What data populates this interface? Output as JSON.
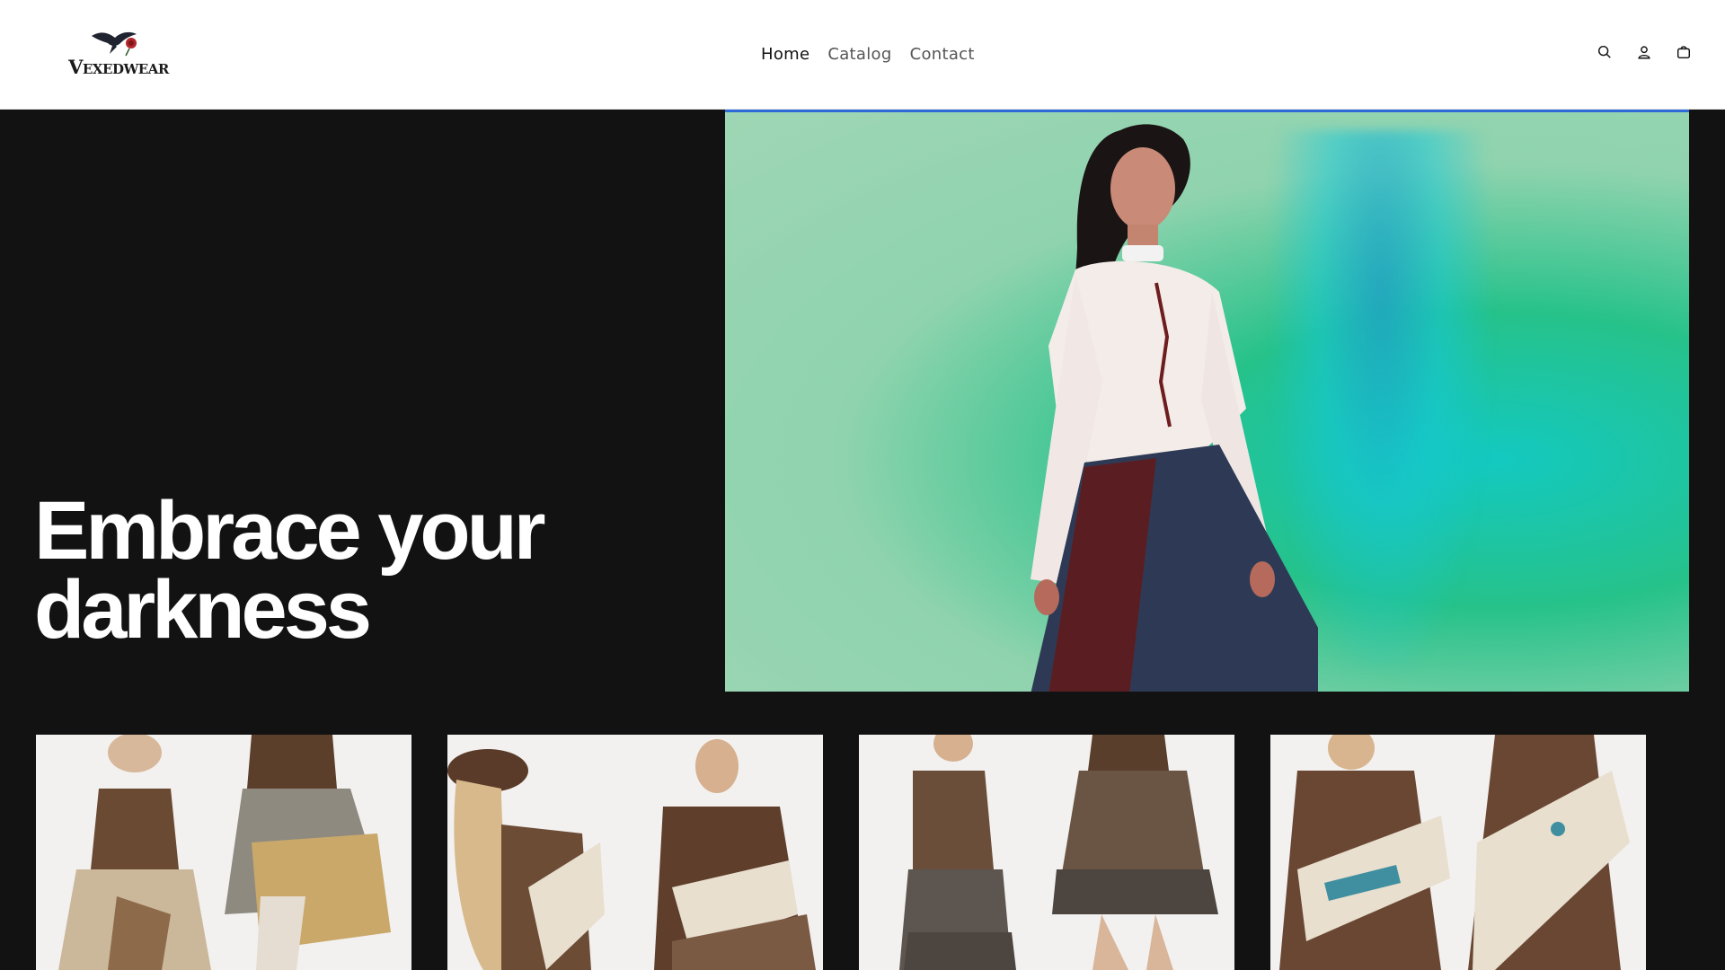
{
  "brand": {
    "name": "Vexedwear"
  },
  "nav": {
    "items": [
      {
        "label": "Home",
        "active": true
      },
      {
        "label": "Catalog",
        "active": false
      },
      {
        "label": "Contact",
        "active": false
      }
    ]
  },
  "header_icons": [
    "search-icon",
    "account-icon",
    "cart-icon"
  ],
  "hero": {
    "heading_line1": "Embrace your",
    "heading_line2": "darkness"
  },
  "products": [
    {
      "name": "product-card-1"
    },
    {
      "name": "product-card-2"
    },
    {
      "name": "product-card-3"
    },
    {
      "name": "product-card-4"
    }
  ],
  "colors": {
    "hero_bg": "#121212",
    "header_bg": "#ffffff",
    "accent_line": "#2f6bd8"
  }
}
